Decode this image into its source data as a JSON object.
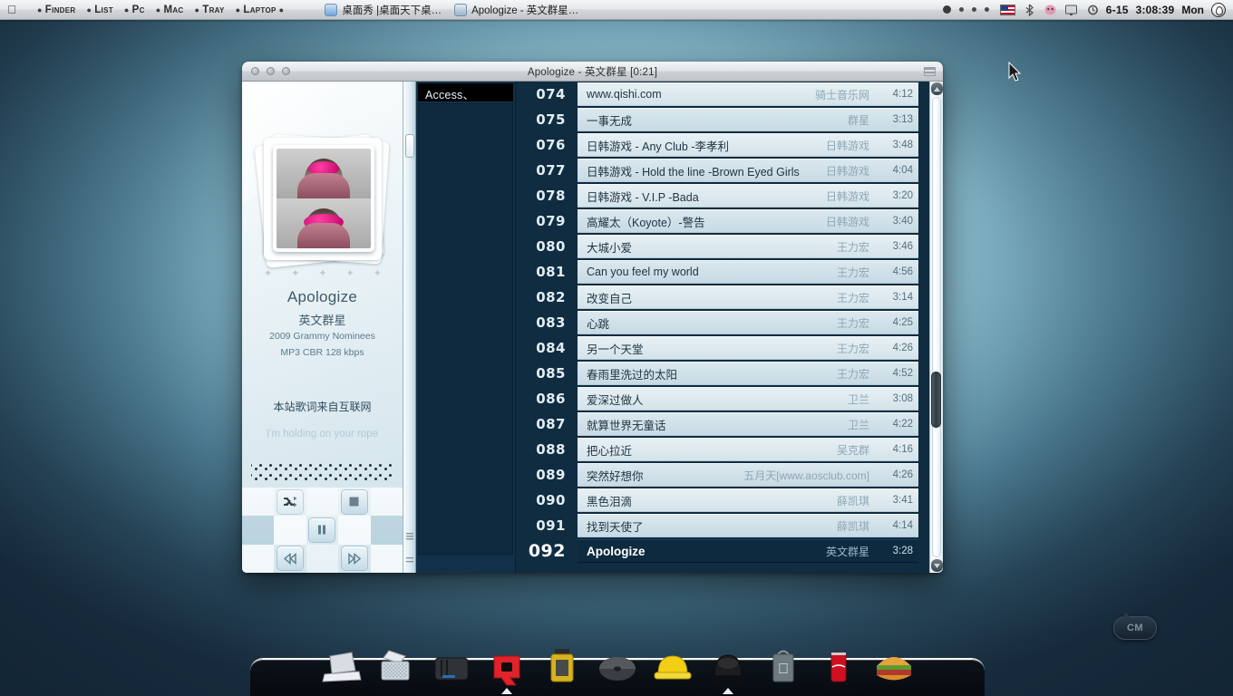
{
  "menubar": {
    "apple_icon": "apple-logo-icon",
    "items": [
      {
        "label": "Finder"
      },
      {
        "label": "List"
      },
      {
        "label": "Pc"
      },
      {
        "label": "Mac"
      },
      {
        "label": "Tray"
      },
      {
        "label": "Laptop"
      }
    ],
    "tasks": [
      {
        "label": "桌面秀 |桌面天下桌…",
        "icon": "window-icon"
      },
      {
        "label": "Apologize - 英文群星…",
        "icon": "music-window-icon"
      }
    ],
    "tray": {
      "flag": "us-flag-icon",
      "icons": [
        "bluetooth-icon",
        "pink-widget-icon",
        "display-icon",
        "timemachine-icon"
      ],
      "date": "6-15",
      "time": "3:08:39",
      "day": "Mon",
      "spotlight": "spotlight-icon"
    }
  },
  "window": {
    "title": "Apologize - 英文群星 [0:21]",
    "traffic_lights": [
      "close",
      "minimize",
      "zoom"
    ]
  },
  "nowplaying": {
    "title": "Apologize",
    "artist": "英文群星",
    "album": "2009 Grammy Nominees",
    "format": "MP3  CBR  128 kbps",
    "rating": "★ ★ ★ ★ ★",
    "lyric_source": "本站歌词来自互联网",
    "lyric_line": "I'm holding on your rope",
    "artwork": "album-artwork-two-photos"
  },
  "controls": {
    "shuffle": "shuffle-icon",
    "stop": "stop-icon",
    "pause": "pause-icon",
    "previous": "previous-icon",
    "next": "next-icon"
  },
  "sidebar": {
    "header": "Access、",
    "items": []
  },
  "playlist": {
    "rows": [
      {
        "index": "074",
        "title": "www.qishi.com",
        "artist": "骑士音乐网",
        "time": "4:12",
        "playing": false
      },
      {
        "index": "075",
        "title": "一事无成",
        "artist": "群星",
        "time": "3:13",
        "playing": false
      },
      {
        "index": "076",
        "title": "日韩游戏 - Any Club -李孝利",
        "artist": "日韩游戏",
        "time": "3:48",
        "playing": false
      },
      {
        "index": "077",
        "title": "日韩游戏 - Hold the line -Brown Eyed Girls",
        "artist": "日韩游戏",
        "time": "4:04",
        "playing": false
      },
      {
        "index": "078",
        "title": "日韩游戏 - V.I.P -Bada",
        "artist": "日韩游戏",
        "time": "3:20",
        "playing": false
      },
      {
        "index": "079",
        "title": "高耀太（Koyote）-警告",
        "artist": "日韩游戏",
        "time": "3:40",
        "playing": false
      },
      {
        "index": "080",
        "title": "大城小爱",
        "artist": "王力宏",
        "time": "3:46",
        "playing": false
      },
      {
        "index": "081",
        "title": "Can you feel my world",
        "artist": "王力宏",
        "time": "4:56",
        "playing": false
      },
      {
        "index": "082",
        "title": "改变自己",
        "artist": "王力宏",
        "time": "3:14",
        "playing": false
      },
      {
        "index": "083",
        "title": "心跳",
        "artist": "王力宏",
        "time": "4:25",
        "playing": false
      },
      {
        "index": "084",
        "title": "另一个天堂",
        "artist": "王力宏",
        "time": "4:26",
        "playing": false
      },
      {
        "index": "085",
        "title": "春雨里洗过的太阳",
        "artist": "王力宏",
        "time": "4:52",
        "playing": false
      },
      {
        "index": "086",
        "title": "爱深过做人",
        "artist": "卫兰",
        "time": "3:08",
        "playing": false
      },
      {
        "index": "087",
        "title": "就算世界无童话",
        "artist": "卫兰",
        "time": "4:22",
        "playing": false
      },
      {
        "index": "088",
        "title": "把心拉近",
        "artist": "吴克群",
        "time": "4:16",
        "playing": false
      },
      {
        "index": "089",
        "title": "突然好想你",
        "artist": "五月天[www.aosclub.com]",
        "time": "4:26",
        "playing": false
      },
      {
        "index": "090",
        "title": "黑色泪滴",
        "artist": "薛凯琪",
        "time": "3:41",
        "playing": false
      },
      {
        "index": "091",
        "title": "找到天使了",
        "artist": "薛凯琪",
        "time": "4:14",
        "playing": false
      },
      {
        "index": "092",
        "title": "Apologize",
        "artist": "英文群星",
        "time": "3:28",
        "playing": true
      }
    ]
  },
  "dock": {
    "items": [
      {
        "name": "laptop-icon"
      },
      {
        "name": "printer-icon"
      },
      {
        "name": "harddrive-icon"
      },
      {
        "name": "red-q-icon"
      },
      {
        "name": "film-canister-icon"
      },
      {
        "name": "disc-icon"
      },
      {
        "name": "yellow-helmet-icon"
      },
      {
        "name": "black-helmet-icon"
      },
      {
        "name": "apple-bag-icon"
      },
      {
        "name": "coca-cola-can-icon"
      },
      {
        "name": "burger-icon"
      }
    ]
  },
  "desktop_widget": {
    "label": "CM"
  },
  "colors": {
    "desktop_top": "#16293a",
    "desktop_mid": "#7fb0c2",
    "accent_dark": "#0f2c41",
    "playlist_row": "#e7f0f4",
    "sidebar_dark": "#113149"
  }
}
